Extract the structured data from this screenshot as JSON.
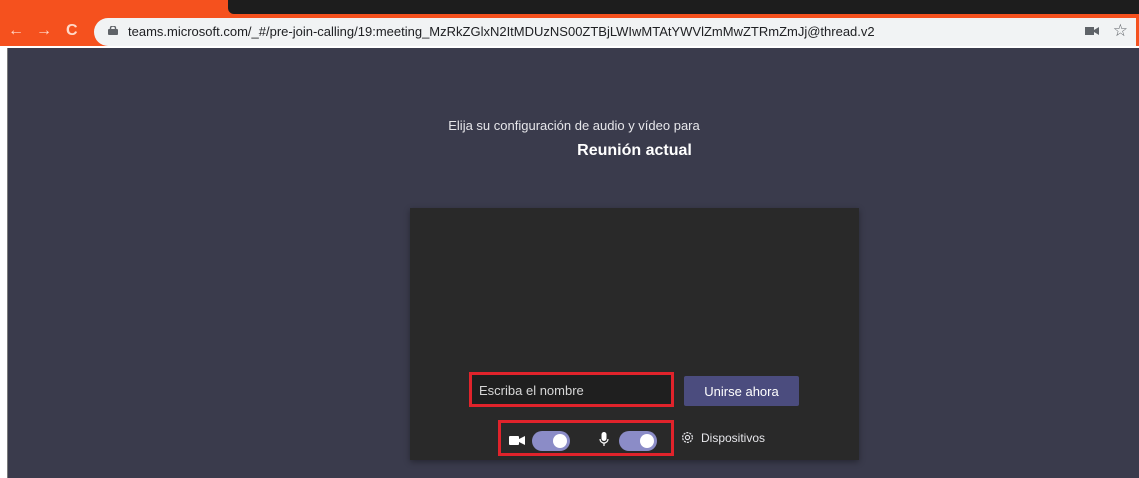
{
  "browser": {
    "url": "teams.microsoft.com/_#/pre-join-calling/19:meeting_MzRkZGlxN2ItMDUzNS00ZTBjLWIwMTAtYWVlZmMwZTRmZmJj@thread.v2",
    "back_glyph": "←",
    "forward_glyph": "→",
    "reload_glyph": "C",
    "star_glyph": "☆"
  },
  "prejoin": {
    "subtitle": "Elija su configuración de audio y vídeo para",
    "meeting_title": "Reunión actual",
    "name_placeholder": "Escriba el nombre",
    "join_label": "Unirse ahora",
    "camera_on": true,
    "mic_on": true,
    "devices_label": "Dispositivos"
  },
  "colors": {
    "browser_accent": "#f5511e",
    "app_background": "#3a3b4c",
    "join_button": "#4b4c7e",
    "toggle_on": "#8b8cc7",
    "highlight_box": "#e0232b"
  }
}
